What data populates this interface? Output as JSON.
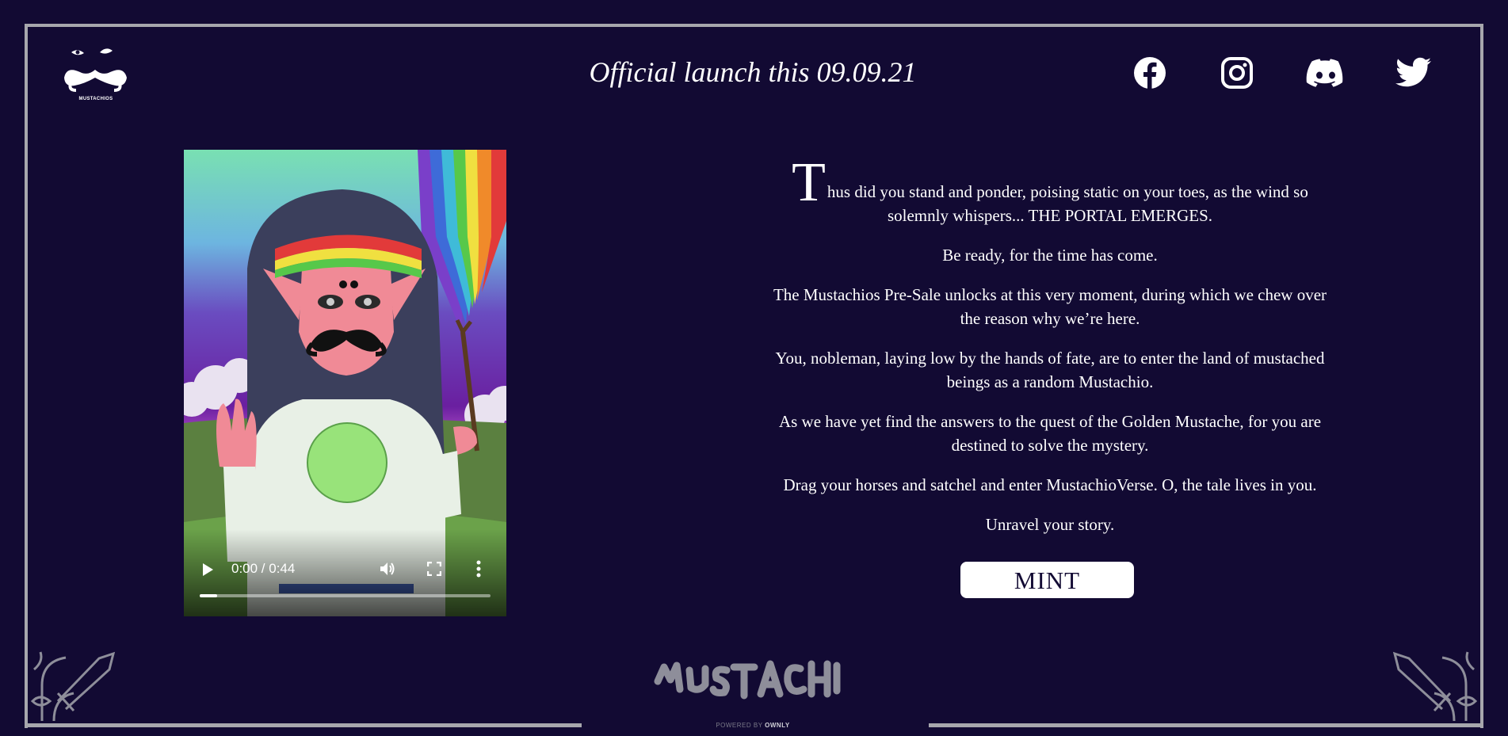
{
  "header": {
    "logo_caption": "MUSTACHIOS",
    "launch_text": "Official launch this 09.09.21",
    "social": [
      {
        "name": "facebook",
        "icon": "facebook-icon"
      },
      {
        "name": "instagram",
        "icon": "instagram-icon"
      },
      {
        "name": "discord",
        "icon": "discord-icon"
      },
      {
        "name": "twitter",
        "icon": "twitter-icon"
      }
    ]
  },
  "video": {
    "time_display": "0:00 / 0:44",
    "progress": 0.06
  },
  "story": {
    "dropcap": "T",
    "p1_rest": "hus did you stand and ponder, poising static on your toes, as the wind so solemnly whispers... THE PORTAL EMERGES.",
    "p2": "Be ready, for the time has come.",
    "p3": "The Mustachios Pre-Sale unlocks at this very moment, during which we chew over the reason why we’re here.",
    "p4": "You, nobleman, laying low by the hands of fate, are to enter the land of mustached beings as a random Mustachio.",
    "p5": "As we have yet find the answers to the quest of the Golden Mustache, for you are destined to solve the mystery.",
    "p6": "Drag your horses and satchel and enter MustachioVerse. O, the tale lives in you.",
    "p7": "Unravel your story."
  },
  "mint_button": "MINT",
  "footer": {
    "powered_prefix": "POWERED BY",
    "powered_brand": "OWNLY"
  },
  "colors": {
    "background": "#120a33",
    "frame": "#a7a7ad",
    "text": "#ffffff"
  }
}
